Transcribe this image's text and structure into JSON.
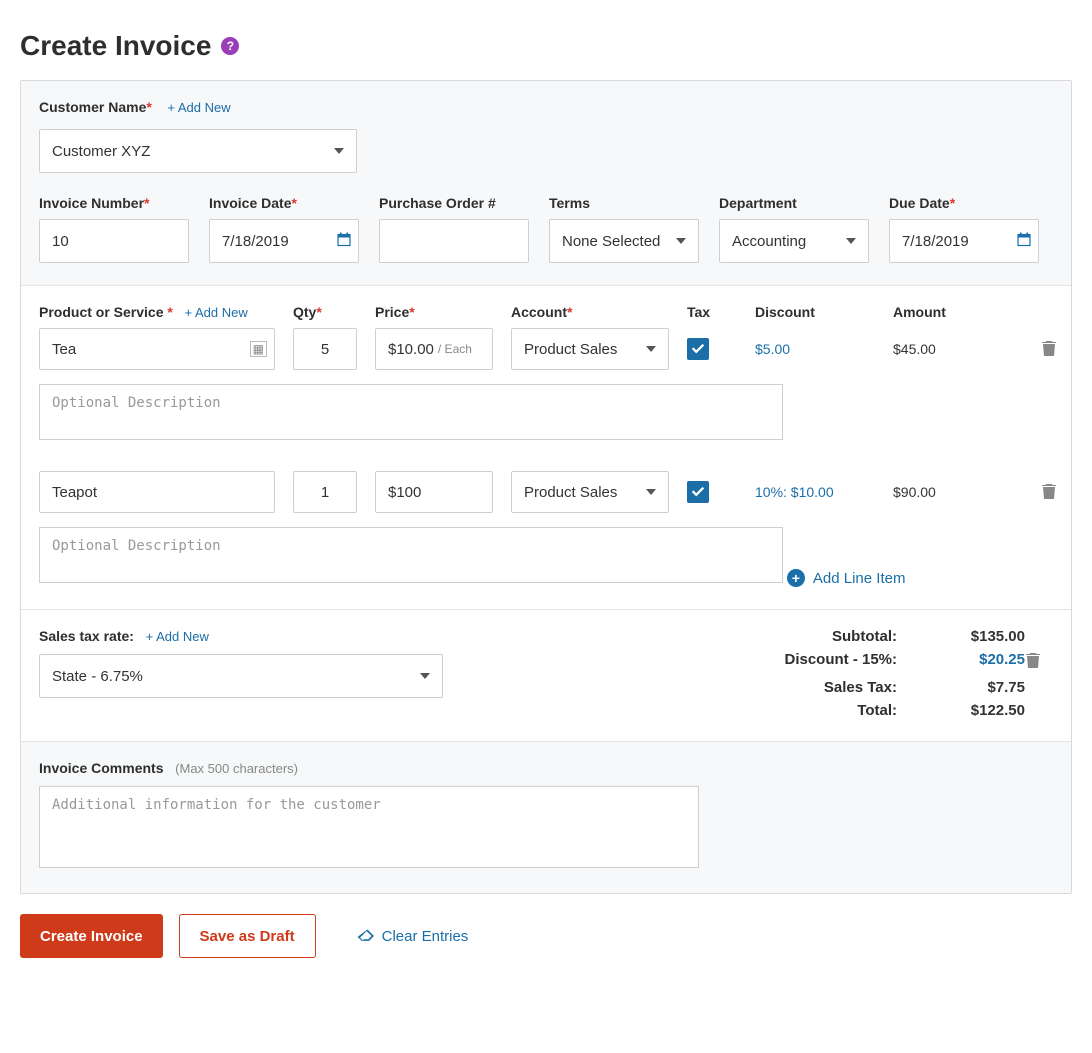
{
  "title": "Create Invoice",
  "header": {
    "customer_label": "Customer Name",
    "add_new": "+ Add New",
    "customer_value": "Customer XYZ",
    "fields": {
      "invoice_number": {
        "label": "Invoice Number",
        "value": "10"
      },
      "invoice_date": {
        "label": "Invoice Date",
        "value": "7/18/2019"
      },
      "po": {
        "label": "Purchase Order #",
        "value": ""
      },
      "terms": {
        "label": "Terms",
        "value": "None Selected"
      },
      "department": {
        "label": "Department",
        "value": "Accounting"
      },
      "due_date": {
        "label": "Due Date",
        "value": "7/18/2019"
      }
    }
  },
  "lines_header": {
    "product": "Product or Service",
    "add_new": "+ Add New",
    "qty": "Qty",
    "price": "Price",
    "account": "Account",
    "tax": "Tax",
    "discount": "Discount",
    "amount": "Amount"
  },
  "lines": [
    {
      "product": "Tea",
      "qty": "5",
      "price": "$10.00",
      "price_unit": "/ Each",
      "account": "Product Sales",
      "tax_checked": true,
      "discount": "$5.00",
      "amount": "$45.00",
      "description_placeholder": "Optional Description"
    },
    {
      "product": "Teapot",
      "qty": "1",
      "price": "$100",
      "price_unit": "",
      "account": "Product Sales",
      "tax_checked": true,
      "discount": "10%: $10.00",
      "amount": "$90.00",
      "description_placeholder": "Optional Description"
    }
  ],
  "add_line": "Add Line Item",
  "tax_section": {
    "label": "Sales tax rate:",
    "add_new": "+ Add New",
    "value": "State - 6.75%"
  },
  "totals": {
    "subtotal_label": "Subtotal:",
    "subtotal": "$135.00",
    "discount_label": "Discount - 15%:",
    "discount": "$20.25",
    "salestax_label": "Sales Tax:",
    "salestax": "$7.75",
    "total_label": "Total:",
    "total": "$122.50"
  },
  "comments": {
    "label": "Invoice Comments",
    "hint": "(Max 500 characters)",
    "placeholder": "Additional information for the customer"
  },
  "footer": {
    "create": "Create Invoice",
    "draft": "Save as Draft",
    "clear": "Clear Entries"
  }
}
